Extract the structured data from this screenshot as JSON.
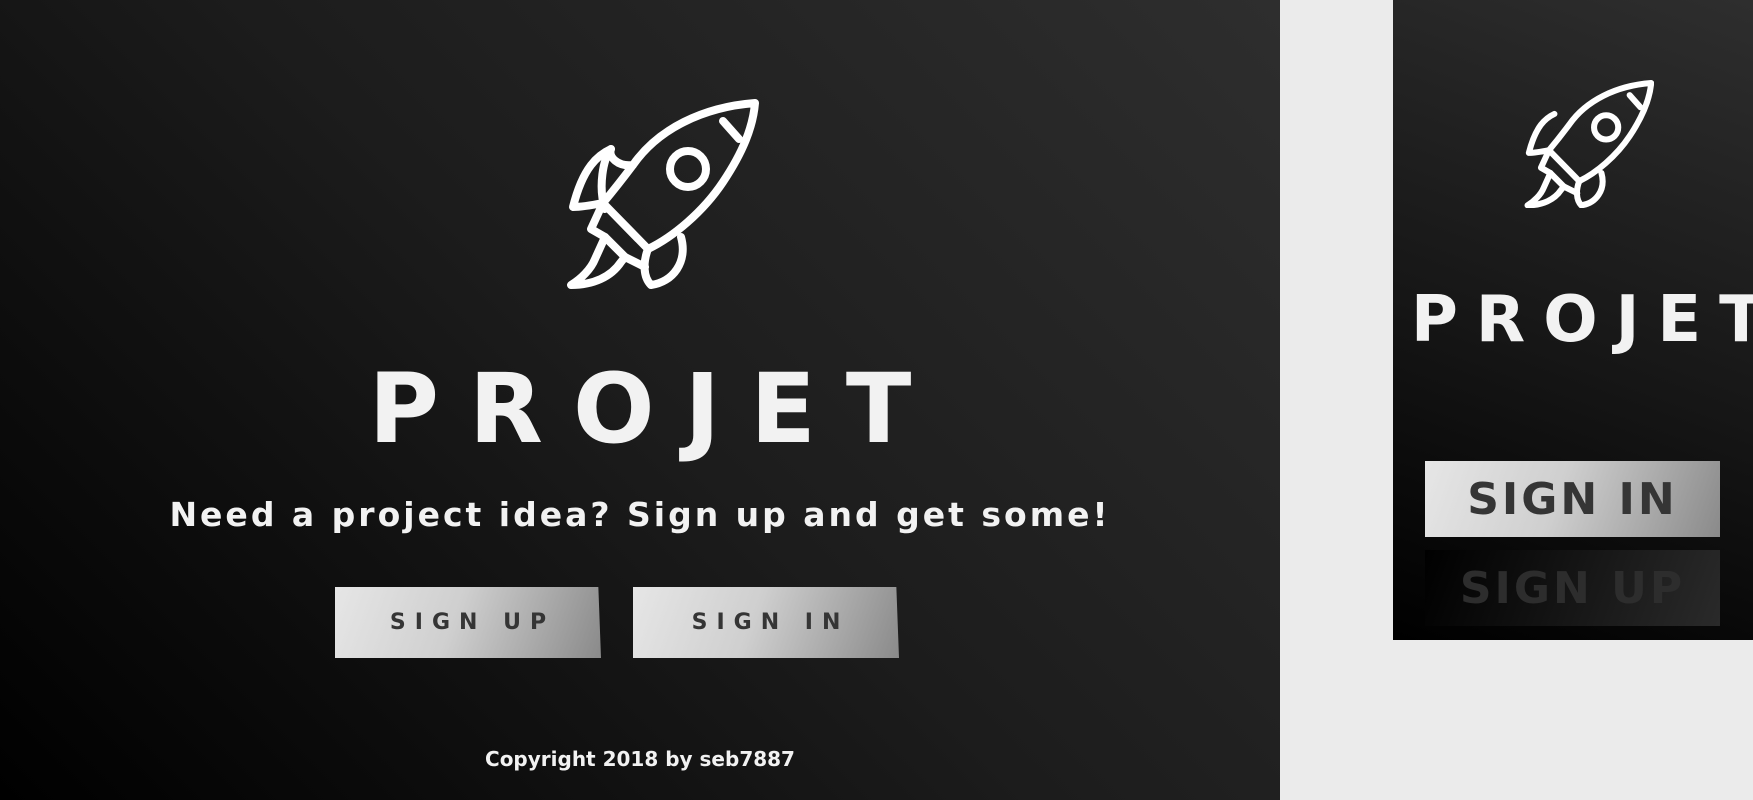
{
  "desktop": {
    "logo_icon": "rocket-icon",
    "title": "PROJET",
    "tagline": "Need a project idea? Sign up and get some!",
    "signup_label": "SIGN UP",
    "signin_label": "SIGN IN",
    "footer": "Copyright 2018 by seb7887"
  },
  "mobile": {
    "logo_icon": "rocket-icon",
    "title": "PROJET",
    "signin_label": "SIGN IN",
    "signup_label": "SIGN UP"
  },
  "colors": {
    "text": "#f2f2f2",
    "button_text": "#353535",
    "background_light": "#ebebeb",
    "background_dark": "#000000"
  }
}
